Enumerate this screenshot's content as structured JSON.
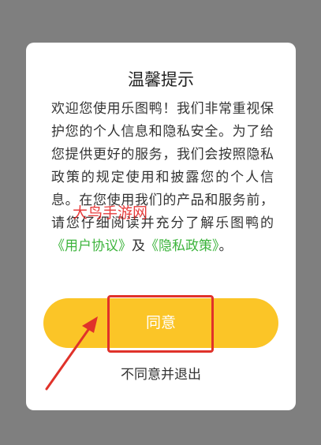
{
  "dialog": {
    "title": "温馨提示",
    "body_text": "欢迎您使用乐图鸭！我们非常重视保护您的个人信息和隐私安全。为了给您提供更好的服务，我们会按照隐私政策的规定使用和披露您的个人信息。在您使用我们的产品和服务前，请您仔细阅读并充分了解乐图鸭的",
    "user_agreement_link": "《用户协议》",
    "conjunction": "及",
    "privacy_policy_link": "《隐私政策》",
    "end_punctuation": "。",
    "agree_label": "同意",
    "decline_label": "不同意并退出"
  },
  "watermark": "大鸟手游网",
  "colors": {
    "overlay": "#7f7f7f",
    "accent": "#fbc527",
    "link": "#3cb43c",
    "annotation": "#e0322a"
  }
}
